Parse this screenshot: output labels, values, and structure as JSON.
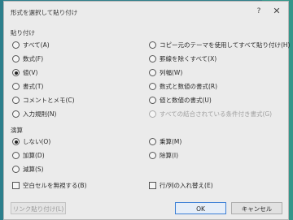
{
  "dialog": {
    "title": "形式を選択して貼り付け",
    "help_glyph": "?",
    "close_glyph": "✕"
  },
  "paste": {
    "label": "貼り付け",
    "left": [
      {
        "label": "すべて(A)",
        "checked": false
      },
      {
        "label": "数式(F)",
        "checked": false
      },
      {
        "label": "値(V)",
        "checked": true
      },
      {
        "label": "書式(T)",
        "checked": false
      },
      {
        "label": "コメントとメモ(C)",
        "checked": false
      },
      {
        "label": "入力規則(N)",
        "checked": false
      }
    ],
    "right": [
      {
        "label": "コピー元のテーマを使用してすべて貼り付け(H)",
        "checked": false,
        "disabled": false
      },
      {
        "label": "罫線を除くすべて(X)",
        "checked": false,
        "disabled": false
      },
      {
        "label": "列幅(W)",
        "checked": false,
        "disabled": false
      },
      {
        "label": "数式と数値の書式(R)",
        "checked": false,
        "disabled": false
      },
      {
        "label": "値と数値の書式(U)",
        "checked": false,
        "disabled": false
      },
      {
        "label": "すべての結合されている条件付き書式(G)",
        "checked": false,
        "disabled": true
      }
    ]
  },
  "operation": {
    "label": "演算",
    "left": [
      {
        "label": "しない(O)",
        "checked": true
      },
      {
        "label": "加算(D)",
        "checked": false
      },
      {
        "label": "減算(S)",
        "checked": false
      }
    ],
    "right": [
      {
        "label": "乗算(M)",
        "checked": false
      },
      {
        "label": "除算(I)",
        "checked": false
      }
    ]
  },
  "options": {
    "skip_blanks": {
      "label": "空白セルを無視する(B)",
      "checked": false
    },
    "transpose": {
      "label": "行/列の入れ替え(E)",
      "checked": false
    }
  },
  "buttons": {
    "paste_link": "リンク貼り付け(L)",
    "ok": "OK",
    "cancel": "キャンセル"
  }
}
